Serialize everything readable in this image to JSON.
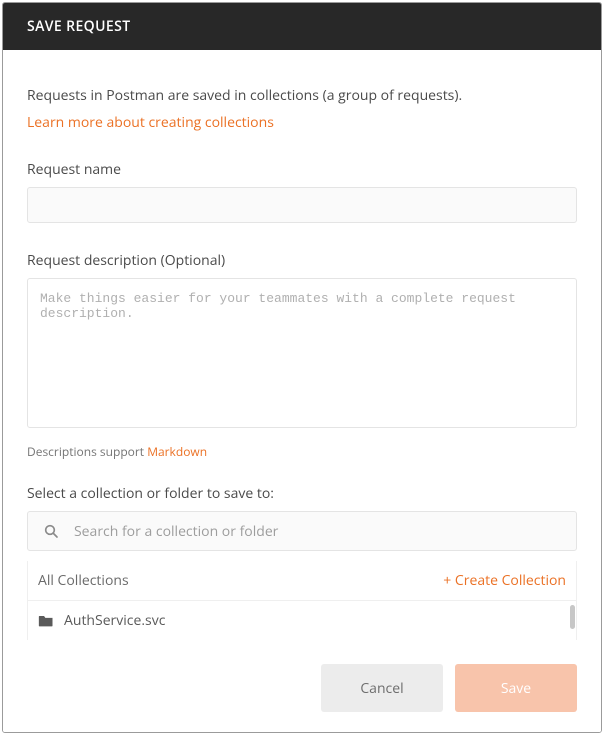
{
  "header": {
    "title": "SAVE REQUEST"
  },
  "intro": {
    "text": "Requests in Postman are saved in collections (a group of requests).",
    "link": "Learn more about creating collections"
  },
  "request_name": {
    "label": "Request name",
    "value": ""
  },
  "request_description": {
    "label": "Request description (Optional)",
    "value": "",
    "placeholder": "Make things easier for your teammates with a complete request description."
  },
  "description_hint": {
    "prefix": "Descriptions support ",
    "link": "Markdown"
  },
  "collections": {
    "label": "Select a collection or folder to save to:",
    "search_placeholder": "Search for a collection or folder",
    "all_label": "All Collections",
    "create_label": "+ Create Collection",
    "items": [
      {
        "name": "AuthService.svc"
      }
    ]
  },
  "footer": {
    "cancel": "Cancel",
    "save": "Save"
  }
}
